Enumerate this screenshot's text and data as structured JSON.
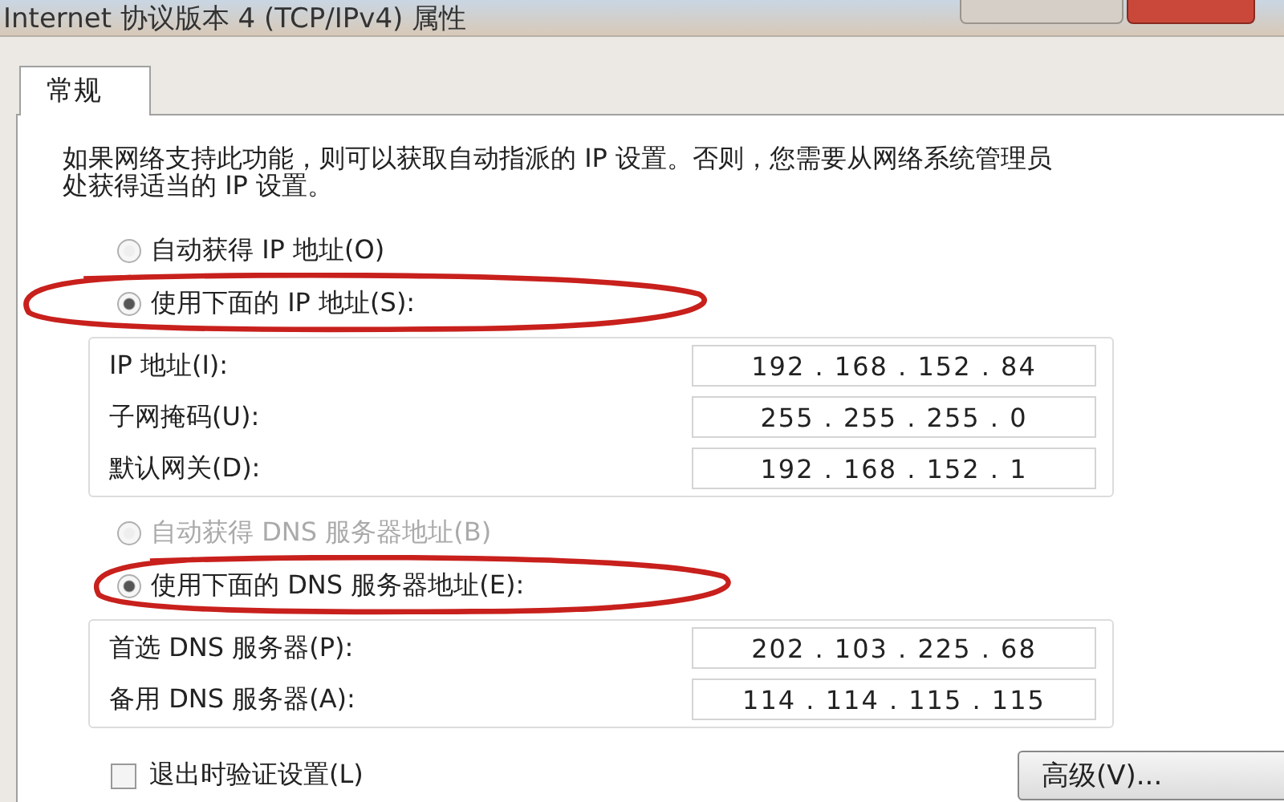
{
  "window": {
    "title": "Internet 协议版本 4 (TCP/IPv4) 属性"
  },
  "tabs": [
    {
      "label": "常规",
      "selected": true
    }
  ],
  "intro": "如果网络支持此功能，则可以获取自动指派的 IP 设置。否则，您需要从网络系统管理员处获得适当的 IP 设置。",
  "ip_section": {
    "options": [
      {
        "label": "自动获得 IP 地址(O)",
        "selected": false,
        "disabled": false,
        "circled": false
      },
      {
        "label": "使用下面的 IP 地址(S):",
        "selected": true,
        "disabled": false,
        "circled": true
      }
    ],
    "fields": [
      {
        "label": "IP 地址(I):",
        "value": "192 . 168 . 152 . 84"
      },
      {
        "label": "子网掩码(U):",
        "value": "255 . 255 . 255 . 0"
      },
      {
        "label": "默认网关(D):",
        "value": "192 . 168 . 152 . 1"
      }
    ]
  },
  "dns_section": {
    "options": [
      {
        "label": "自动获得 DNS 服务器地址(B)",
        "selected": false,
        "disabled": true,
        "circled": false
      },
      {
        "label": "使用下面的 DNS 服务器地址(E):",
        "selected": true,
        "disabled": false,
        "circled": true
      }
    ],
    "fields": [
      {
        "label": "首选 DNS 服务器(P):",
        "value": "202 . 103 . 225 . 68"
      },
      {
        "label": "备用 DNS 服务器(A):",
        "value": "114 . 114 . 115 . 115"
      }
    ]
  },
  "validate_on_exit": {
    "label": "退出时验证设置(L)",
    "checked": false
  },
  "buttons": [
    "高级(V)..."
  ]
}
